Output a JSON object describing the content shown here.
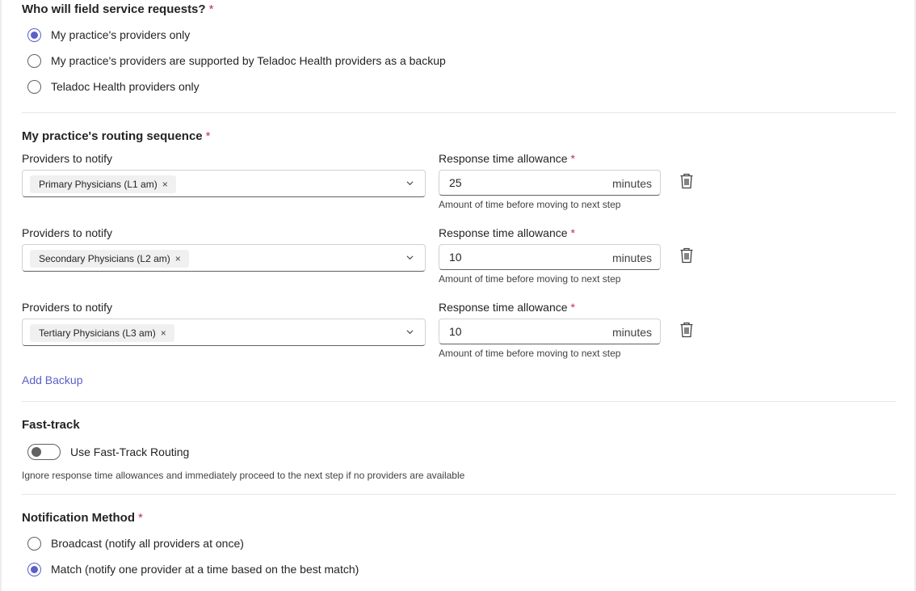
{
  "field_service": {
    "title": "Who will field service requests?",
    "required_mark": "*",
    "options": [
      {
        "label": "My practice's providers only",
        "selected": true
      },
      {
        "label": "My practice's providers are supported by Teladoc Health providers as a backup",
        "selected": false
      },
      {
        "label": "Teladoc Health providers only",
        "selected": false
      }
    ]
  },
  "routing": {
    "title": "My practice's routing sequence",
    "required_mark": "*",
    "steps": [
      {
        "providers_label": "Providers to notify",
        "tag": "Primary Physicians (L1 am)",
        "tag_remove": "×",
        "time_label": "Response time allowance",
        "time_value": "25",
        "unit": "minutes",
        "hint": "Amount of time before moving to next step"
      },
      {
        "providers_label": "Providers to notify",
        "tag": "Secondary Physicians (L2 am)",
        "tag_remove": "×",
        "time_label": "Response time allowance",
        "time_value": "10",
        "unit": "minutes",
        "hint": "Amount of time before moving to next step"
      },
      {
        "providers_label": "Providers to notify",
        "tag": "Tertiary Physicians (L3 am)",
        "tag_remove": "×",
        "time_label": "Response time allowance",
        "time_value": "10",
        "unit": "minutes",
        "hint": "Amount of time before moving to next step"
      }
    ],
    "add_backup": "Add Backup"
  },
  "fast_track": {
    "title": "Fast-track",
    "toggle_label": "Use Fast-Track Routing",
    "toggle_on": false,
    "description": "Ignore response time allowances and immediately proceed to the next step if no providers are available"
  },
  "notification": {
    "title": "Notification Method",
    "required_mark": "*",
    "options": [
      {
        "label": "Broadcast (notify all providers at once)",
        "selected": false
      },
      {
        "label": "Match (notify one provider at a time based on the best match)",
        "selected": true
      }
    ]
  },
  "colors": {
    "accent": "#5b5fc7",
    "required": "#c4314b",
    "divider": "#e6e6e6"
  }
}
